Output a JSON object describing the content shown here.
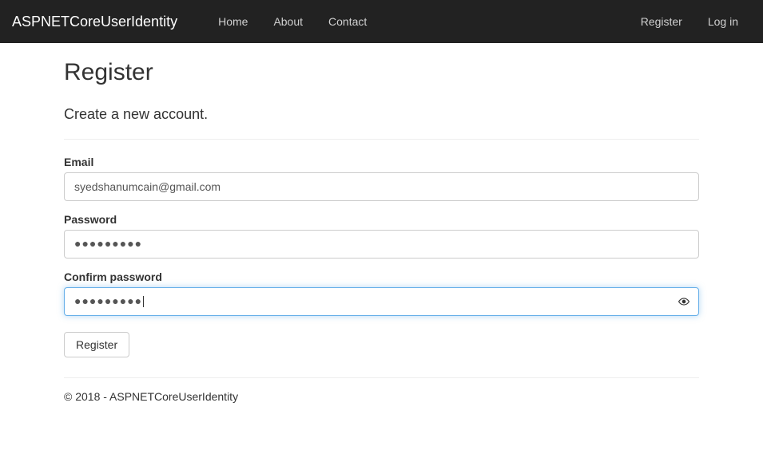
{
  "nav": {
    "brand": "ASPNETCoreUserIdentity",
    "left": [
      {
        "label": "Home"
      },
      {
        "label": "About"
      },
      {
        "label": "Contact"
      }
    ],
    "right": [
      {
        "label": "Register"
      },
      {
        "label": "Log in"
      }
    ]
  },
  "page": {
    "title": "Register",
    "subtitle": "Create a new account."
  },
  "form": {
    "email": {
      "label": "Email",
      "value": "syedshanumcain@gmail.com"
    },
    "password": {
      "label": "Password",
      "mask": "●●●●●●●●●"
    },
    "confirm": {
      "label": "Confirm password",
      "mask": "●●●●●●●●●"
    },
    "submit_label": "Register"
  },
  "footer": {
    "text": "© 2018 - ASPNETCoreUserIdentity"
  }
}
